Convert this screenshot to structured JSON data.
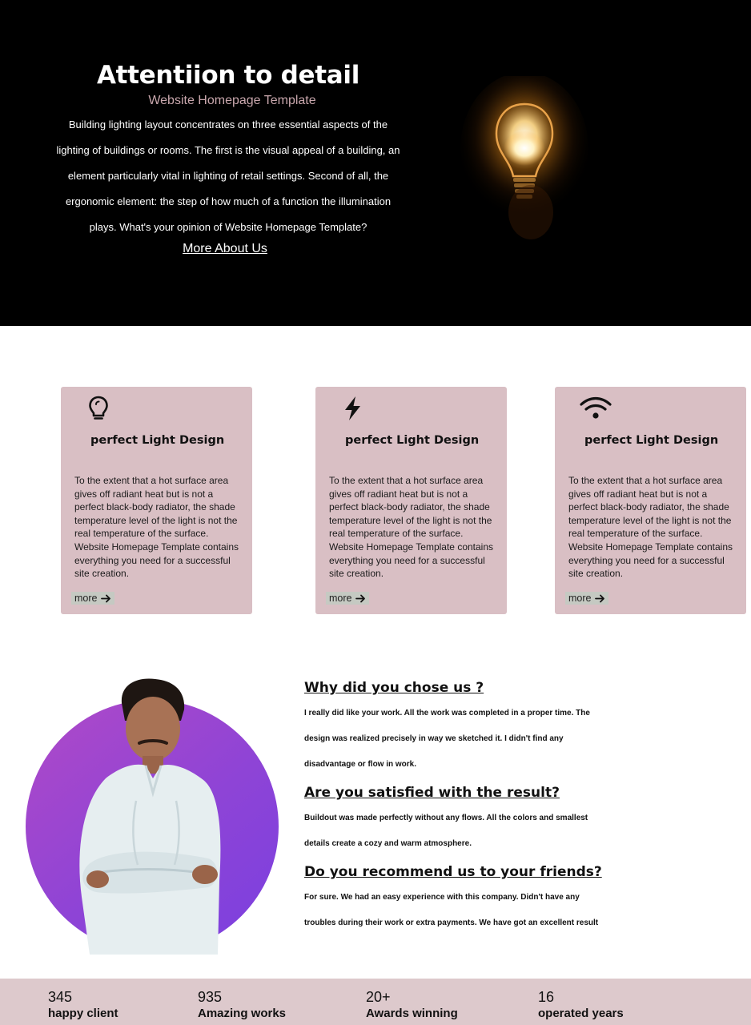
{
  "hero": {
    "title": "Attentiion to detail",
    "subtitle": "Website Homepage Template",
    "body": "Building lighting layout concentrates on three essential aspects of the lighting of buildings or rooms. The first is the visual appeal of a building, an element particularly vital in lighting of retail settings. Second of all, the ergonomic element: the step of how much of a function the illumination plays. What's your opinion of Website Homepage Template?",
    "link_label": "More About Us",
    "image_icon": "light-bulb-glowing"
  },
  "features": [
    {
      "icon": "lightbulb-icon",
      "title": "perfect Light Design",
      "text": "To the extent that a hot surface area gives off radiant heat but is not a perfect black-body radiator, the shade temperature level of the light is not the real temperature of the surface. Website Homepage Template contains everything you need for a successful site creation.",
      "more_label": "more"
    },
    {
      "icon": "bolt-icon",
      "title": "perfect Light Design",
      "text": "To the extent that a hot surface area gives off radiant heat but is not a perfect black-body radiator, the shade temperature level of the light is not the real temperature of the surface. Website Homepage Template contains everything you need for a successful site creation.",
      "more_label": "more"
    },
    {
      "icon": "wifi-icon",
      "title": "perfect Light Design",
      "text": "To the extent that a hot surface area gives off radiant heat but is not a perfect black-body radiator, the shade temperature level of the light is not the real temperature of the surface. Website Homepage Template contains everything you need for a successful site creation.",
      "more_label": "more"
    }
  ],
  "testimonial": {
    "items": [
      {
        "question": "Why did you chose us ?",
        "answer": "I really did like your work. All the work was completed in a proper time. The design was realized precisely in way we sketched it. I didn't find any disadvantage or flow in work."
      },
      {
        "question": "Are you satisfied with the result?",
        "answer": "Buildout was made perfectly without any flows. All the colors and smallest details create a cozy and warm atmosphere."
      },
      {
        "question": "Do you recommend us to your friends?",
        "answer": "For sure. We had an easy experience with this company. Didn't have any troubles during their work or extra payments. We have got an excellent result"
      }
    ]
  },
  "stats": [
    {
      "number": "345",
      "label": "happy client"
    },
    {
      "number": "935",
      "label": "Amazing works"
    },
    {
      "number": "20+",
      "label": "Awards winning"
    },
    {
      "number": "16",
      "label": "operated years"
    }
  ],
  "colors": {
    "hero_bg": "#000000",
    "subtitle": "#c9a7ad",
    "card_bg": "#d9bfc4",
    "more_bg": "#c5c9c2",
    "circle_gradient_start": "#b049c7",
    "circle_gradient_end": "#7a3fe0",
    "stats_bg": "#ddc9cc"
  }
}
